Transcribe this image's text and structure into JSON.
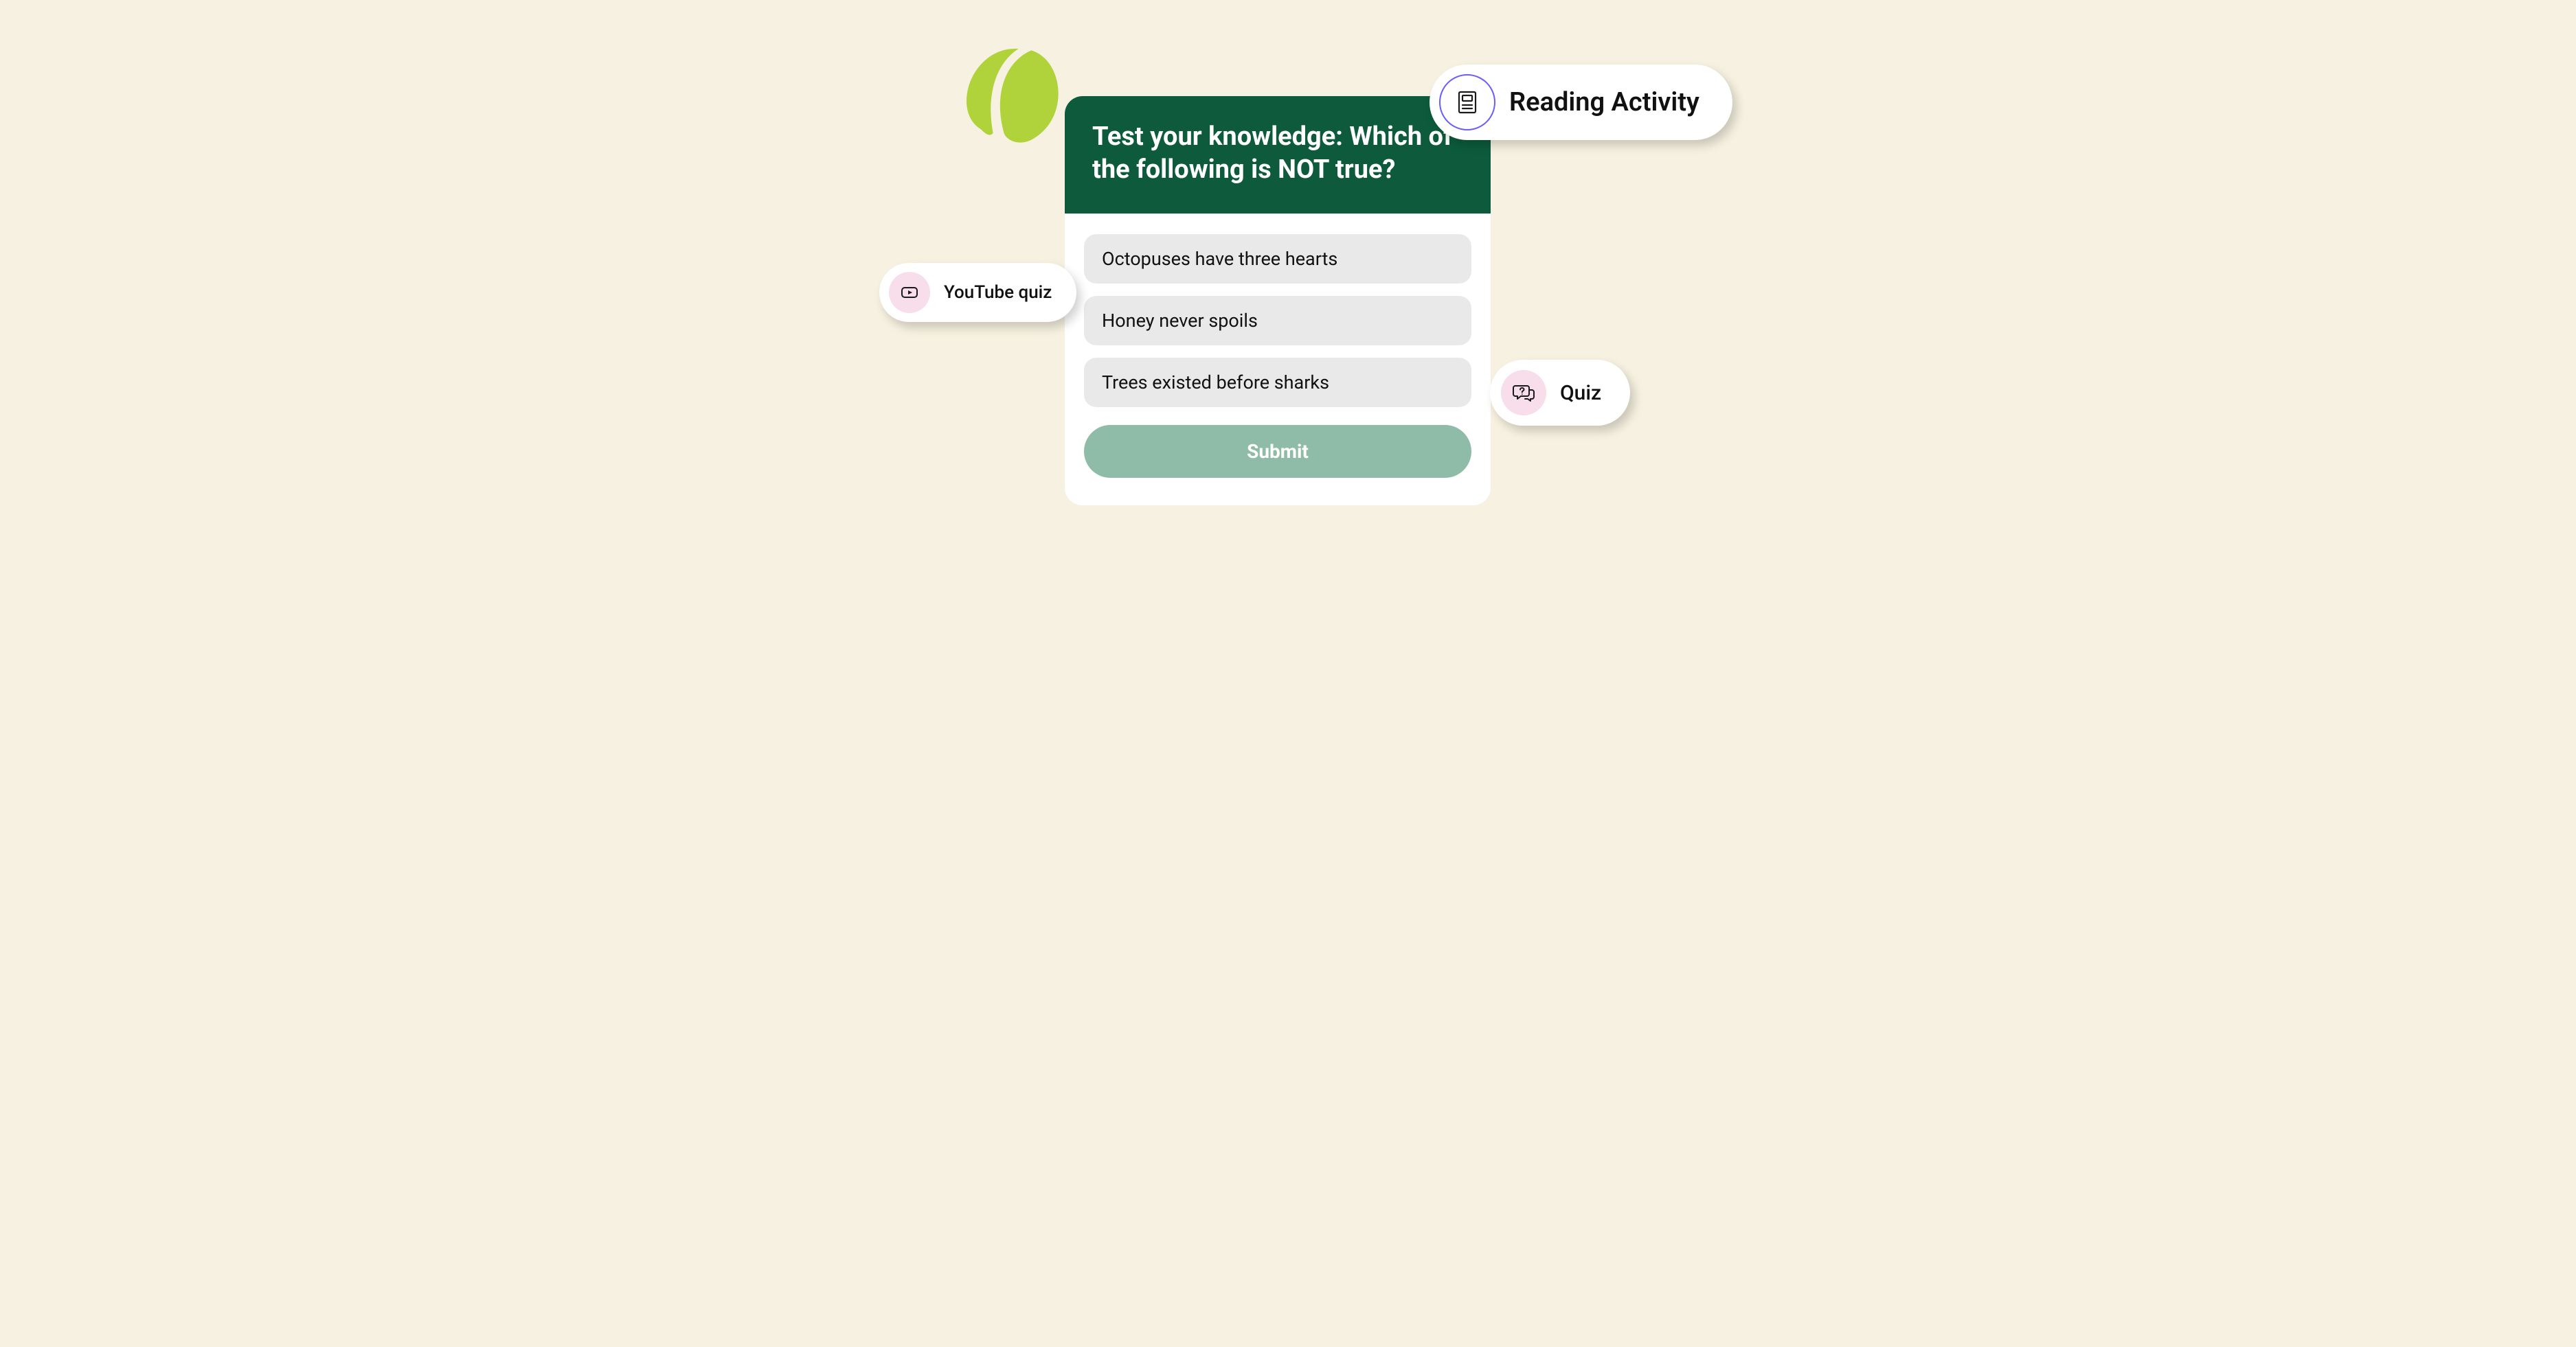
{
  "decor": {
    "bean_color": "#b0d33b"
  },
  "quiz": {
    "question": "Test your knowledge: Which of the following is NOT true?",
    "options": [
      "Octopuses have three hearts",
      "Honey never spoils",
      "Trees existed before sharks"
    ],
    "submit_label": "Submit",
    "colors": {
      "header_bg": "#0d5b3c",
      "submit_bg": "#8fbca8"
    }
  },
  "chips": {
    "reading": {
      "label": "Reading Activity"
    },
    "youtube": {
      "label": "YouTube quiz"
    },
    "quiz": {
      "label": "Quiz"
    }
  }
}
